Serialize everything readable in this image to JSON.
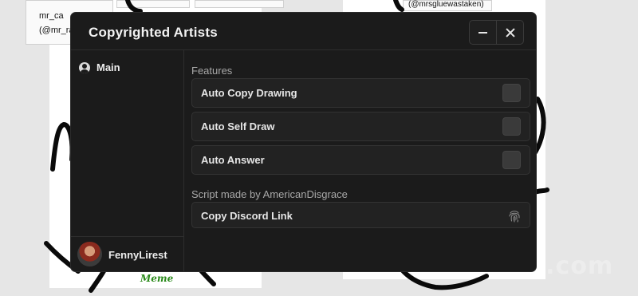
{
  "background": {
    "card_user": "mr_ca",
    "card_handle": "(@mr_ran",
    "card_right": "(@mrsgluewastaken)",
    "meme_text": "Meme",
    "watermark": "rbxscript.com"
  },
  "window": {
    "title": "Copyrighted Artists",
    "minimize_icon": "minus-icon",
    "close_icon": "close-icon"
  },
  "sidebar": {
    "items": [
      {
        "label": "Main",
        "icon": "user-circle-icon"
      }
    ],
    "user": {
      "name": "FennyLirest"
    }
  },
  "main": {
    "features_heading": "Features",
    "features": [
      {
        "label": "Auto Copy Drawing",
        "enabled": false
      },
      {
        "label": "Auto Self Draw",
        "enabled": false
      },
      {
        "label": "Auto Answer",
        "enabled": false
      }
    ],
    "credit_heading": "Script made by AmericanDisgrace",
    "discord_button": {
      "label": "Copy Discord Link",
      "icon": "fingerprint-icon"
    }
  },
  "colors": {
    "window_bg": "#1b1b1b",
    "row_bg": "#222222",
    "toggle_off": "#3a3a3a",
    "text": "#e6e6e6",
    "muted": "#a8a8a8"
  }
}
